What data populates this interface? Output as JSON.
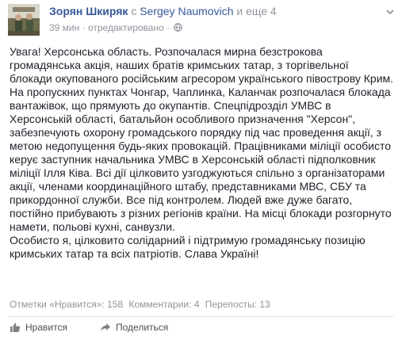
{
  "post": {
    "author": "Зорян Шкиряк",
    "with_prefix": "с",
    "tagged_person": "Sergey Naumovich",
    "and_more": "и еще 4",
    "time": "39 мин",
    "separator": "·",
    "edited": "отредактировано",
    "separator2": "·",
    "privacy_icon": "globe-icon",
    "menu_icon": "chevron-down-icon",
    "text_lines": [
      "Увага! Херсонська область. Розпочалася мирна безстрокова",
      "громадянська акція, наших братів кримських татар, з торгівельної",
      "блокади окупованого російським агресором українського півострову Крим.",
      "На пропускних пунктах Чонгар, Чаплинка, Каланчак розпочалася блокада",
      "вантажівок, що прямують до окупантів. Спецпідрозділ УМВС в",
      "Херсонській області, батальйон особливого призначення \"Херсон\",",
      "забезпечують охорону громадського порядку під час проведення акції, з",
      "метою недопущення будь-яких провокацій. Працівниками міліції особисто",
      "керує заступник начальника УМВС в Херсонській області підполковник",
      "міліції Ілля Ківа. Всі дії цілковито узгоджуються спільно з організаторами",
      "акції, членами координаційного штабу, представниками МВС, СБУ та",
      "прикордонної служби. Все під контролем. Людей вже дуже багато,",
      "постійно прибувають з різних регіонів країни. На місці блокади розгорнуто",
      "намети, польові кухні, санвузли.",
      "Особисто я, цілковито солідарний і підтримую громадянську позицію",
      "кримських татар та всіх патріотів. Слава Україні!"
    ]
  },
  "stats": {
    "likes": "Отметки «Нравится»: 158",
    "comments": "Комментарии: 4",
    "shares": "Перепосты: 13"
  },
  "actions": {
    "like_label": "Нравится",
    "like_icon": "thumbs-up-icon",
    "share_label": "Поделиться",
    "share_icon": "share-arrow-icon"
  },
  "colors": {
    "link": "#365899",
    "muted": "#90949c",
    "text": "#1d2129"
  }
}
